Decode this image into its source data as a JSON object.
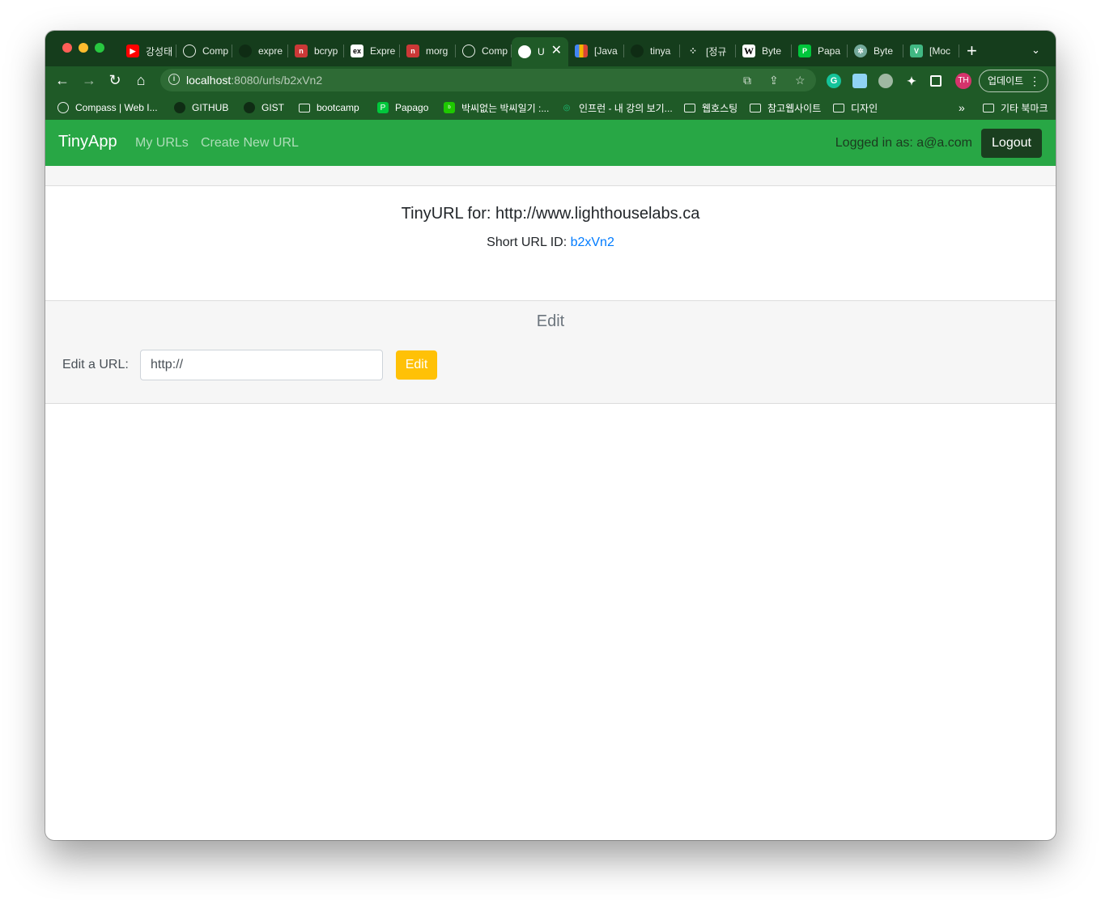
{
  "browser": {
    "tabs": [
      {
        "label": "강성태",
        "icon": "youtube-icon",
        "color": "#ff0000"
      },
      {
        "label": "Comp",
        "icon": "compass-icon",
        "color": "#153d1c"
      },
      {
        "label": "expre",
        "icon": "github-icon",
        "color": "#153d1c"
      },
      {
        "label": "bcryp",
        "icon": "npm-icon",
        "color": "#cb3837"
      },
      {
        "label": "Expre",
        "icon": "express-icon",
        "color": "#ffffff"
      },
      {
        "label": "morg",
        "icon": "npm-icon",
        "color": "#cb3837"
      },
      {
        "label": "Comp",
        "icon": "compass-icon",
        "color": "#153d1c"
      },
      {
        "label": "U",
        "icon": "globe-icon",
        "color": "#ffffff",
        "active": true
      },
      {
        "label": "[Java",
        "icon": "blocks-icon",
        "color": "#f4b400"
      },
      {
        "label": "tinya",
        "icon": "github-icon",
        "color": "#153d1c"
      },
      {
        "label": "[정규",
        "icon": "dots-icon",
        "color": "#153d1c"
      },
      {
        "label": "Byte",
        "icon": "wikipedia-icon",
        "color": "#ffffff"
      },
      {
        "label": "Papa",
        "icon": "papago-icon",
        "color": "#00c73c"
      },
      {
        "label": "Byte",
        "icon": "chatgpt-icon",
        "color": "#74aa9c"
      },
      {
        "label": "[Moc",
        "icon": "vue-icon",
        "color": "#41b883"
      }
    ],
    "address": {
      "host": "localhost",
      "path": ":8080/urls/b2xVn2"
    },
    "profile_initials": "TH",
    "update_label": "업데이트",
    "bookmarks": [
      {
        "label": "Compass | Web I...",
        "icon": "compass-icon"
      },
      {
        "label": "GITHUB",
        "icon": "github-icon"
      },
      {
        "label": "GIST",
        "icon": "github-icon"
      },
      {
        "label": "bootcamp",
        "icon": "folder-icon"
      },
      {
        "label": "Papago",
        "icon": "papago-icon"
      },
      {
        "label": "박씨없는 박씨일기 :...",
        "icon": "blog-icon"
      },
      {
        "label": "인프런 - 내 강의 보기...",
        "icon": "inflearn-icon"
      },
      {
        "label": "웹호스팅",
        "icon": "folder-icon"
      },
      {
        "label": "참고웹사이트",
        "icon": "folder-icon"
      },
      {
        "label": "디자인",
        "icon": "folder-icon"
      }
    ],
    "bookmarks_more": "»",
    "other_bookmarks": "기타 북마크"
  },
  "navbar": {
    "brand": "TinyApp",
    "links": [
      "My URLs",
      "Create New URL"
    ],
    "logged_in_text": "Logged in as: a@a.com",
    "logout_label": "Logout"
  },
  "card": {
    "title": "TinyURL for: http://www.lighthouselabs.ca",
    "short_prefix": "Short URL ID: ",
    "short_id": "b2xVn2"
  },
  "edit": {
    "heading": "Edit",
    "label": "Edit a URL:",
    "input_value": "http://",
    "button_label": "Edit"
  },
  "colors": {
    "navbar": "#28a745",
    "logout": "#1a3f1f",
    "edit_button": "#ffc107",
    "link": "#007bff"
  }
}
